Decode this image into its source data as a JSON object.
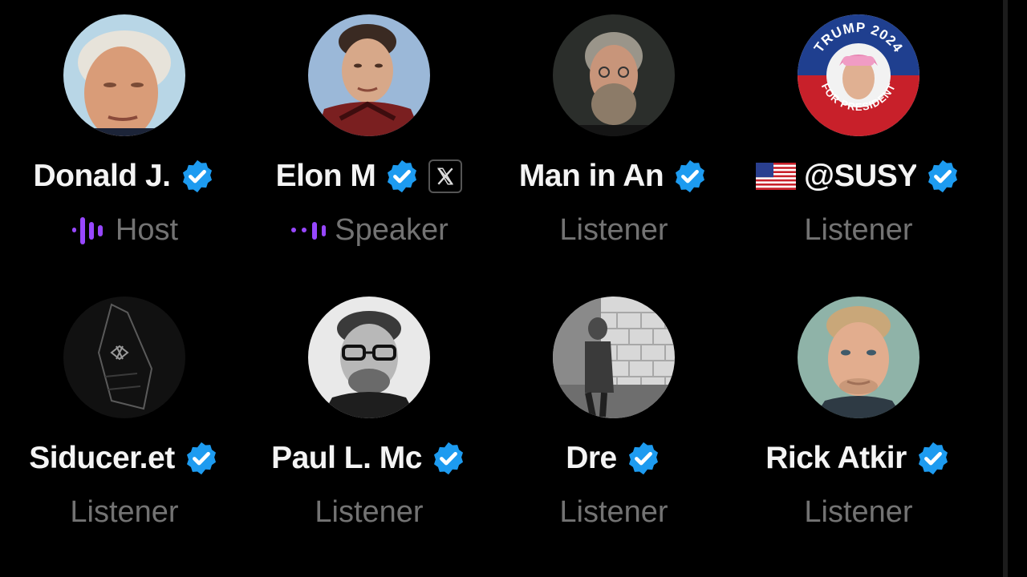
{
  "participants": [
    {
      "name": "Donald J.",
      "role": "Host",
      "verified": true
    },
    {
      "name": "Elon M",
      "role": "Speaker",
      "verified": true,
      "affiliate_badge": "x-logo-icon"
    },
    {
      "name": "Man in An",
      "role": "Listener",
      "verified": true
    },
    {
      "name": "@SUSY",
      "role": "Listener",
      "verified": true,
      "flag": "us-flag-icon"
    },
    {
      "name": "Siducer.et",
      "role": "Listener",
      "verified": true
    },
    {
      "name": "Paul L. Mc",
      "role": "Listener",
      "verified": true
    },
    {
      "name": "Dre",
      "role": "Listener",
      "verified": true
    },
    {
      "name": "Rick Atkir",
      "role": "Listener",
      "verified": true
    }
  ],
  "avatar_badge_text": {
    "top": "TRUMP 2024",
    "bottom": "FOR PRESIDENT"
  },
  "colors": {
    "background": "#000000",
    "name_text": "#f4f4f4",
    "role_text": "#737373",
    "verified_blue": "#1d9bf0",
    "speaking_purple": "#9747ff"
  }
}
